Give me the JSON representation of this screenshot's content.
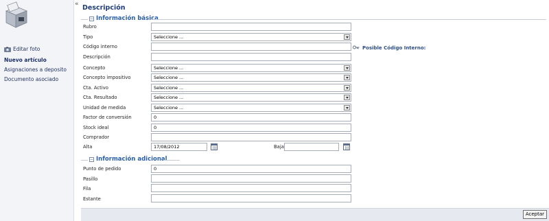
{
  "sidebar": {
    "edit_photo": "Editar foto",
    "items": [
      {
        "label": "Nuevo artículo",
        "active": true
      },
      {
        "label": "Asignaciones a deposito",
        "active": false
      },
      {
        "label": "Documento asociado",
        "active": false
      }
    ],
    "collapse_symbol": "«"
  },
  "main": {
    "title": "Descripción",
    "basic_section": {
      "label": "Información básica",
      "toggle": "−",
      "fields": {
        "rubro": {
          "label": "Rubro",
          "value": ""
        },
        "tipo": {
          "label": "Tipo",
          "value": "Seleccione ..."
        },
        "codigo_interno": {
          "label": "Código interno",
          "value": ""
        },
        "descripcion": {
          "label": "Descripción",
          "value": ""
        },
        "concepto": {
          "label": "Concepto",
          "value": "Seleccione ..."
        },
        "concepto_impositivo": {
          "label": "Concepto impositivo",
          "value": "Seleccione ..."
        },
        "cta_activo": {
          "label": "Cta. Activo",
          "value": "Seleccione ..."
        },
        "cta_resultado": {
          "label": "Cta. Resultado",
          "value": "Seleccione ..."
        },
        "unidad_medida": {
          "label": "Unidad de medida",
          "value": "Seleccione ..."
        },
        "factor_conversion": {
          "label": "Factor de conversión",
          "value": "0"
        },
        "stock_ideal": {
          "label": "Stock ideal",
          "value": "0"
        },
        "comprador": {
          "label": "Comprador",
          "value": ""
        },
        "alta": {
          "label": "Alta",
          "value": "17/08/2012"
        },
        "baja": {
          "label": "Baja",
          "value": ""
        }
      },
      "hint": "Posible Código Interno:"
    },
    "additional_section": {
      "label": "Información adicional",
      "toggle": "−",
      "fields": {
        "punto_pedido": {
          "label": "Punto de pedido",
          "value": "0"
        },
        "pasillo": {
          "label": "Pasillo",
          "value": ""
        },
        "fila": {
          "label": "Fila",
          "value": ""
        },
        "estante": {
          "label": "Estante",
          "value": ""
        }
      }
    }
  },
  "footer": {
    "accept_label": "Aceptar"
  },
  "icons": {
    "product": "product-box-icon",
    "camera": "camera-icon",
    "calendar": "calendar-icon",
    "key": "key-icon",
    "dropdown": "chevron-down-icon"
  },
  "colors": {
    "title": "#1f3b78",
    "section_label": "#2a5fa8",
    "sidebar_bg": "#f3f4f7",
    "footer_bg": "#e6e9ef"
  }
}
